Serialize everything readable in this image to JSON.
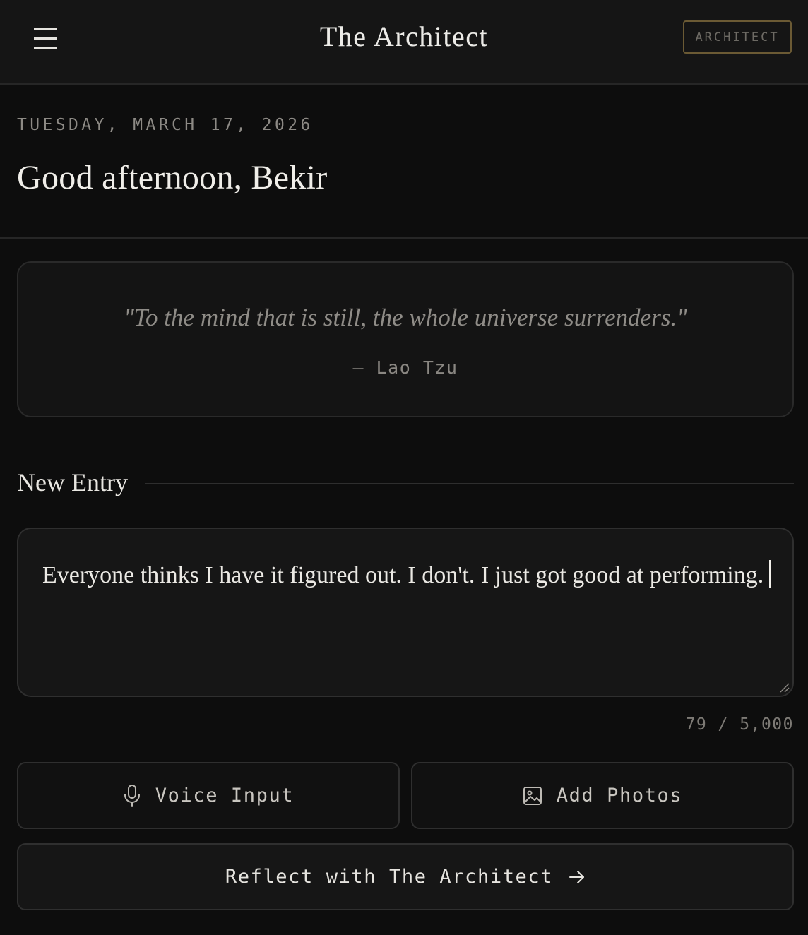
{
  "header": {
    "title": "The Architect",
    "badge": "ARCHITECT",
    "menu_icon": "hamburger-menu-icon"
  },
  "greeting": {
    "date": "TUESDAY, MARCH 17, 2026",
    "message": "Good afternoon, Bekir"
  },
  "quote": {
    "text": "\"To the mind that is still, the whole universe surrenders.\"",
    "author": "— Lao Tzu"
  },
  "entry": {
    "section_title": "New Entry",
    "value": "Everyone thinks I have it figured out. I don't. I just got good at performing.",
    "char_count": "79 / 5,000"
  },
  "actions": {
    "voice_label": "Voice Input",
    "voice_icon": "microphone-icon",
    "photos_label": "Add Photos",
    "photos_icon": "image-icon",
    "reflect_label": "Reflect with The Architect",
    "reflect_icon": "arrow-right-icon"
  },
  "colors": {
    "background": "#0d0d0d",
    "header_bg": "#151515",
    "accent_border": "#6b5a34",
    "text_primary": "#ecebe7",
    "text_muted": "#8d8a85"
  }
}
